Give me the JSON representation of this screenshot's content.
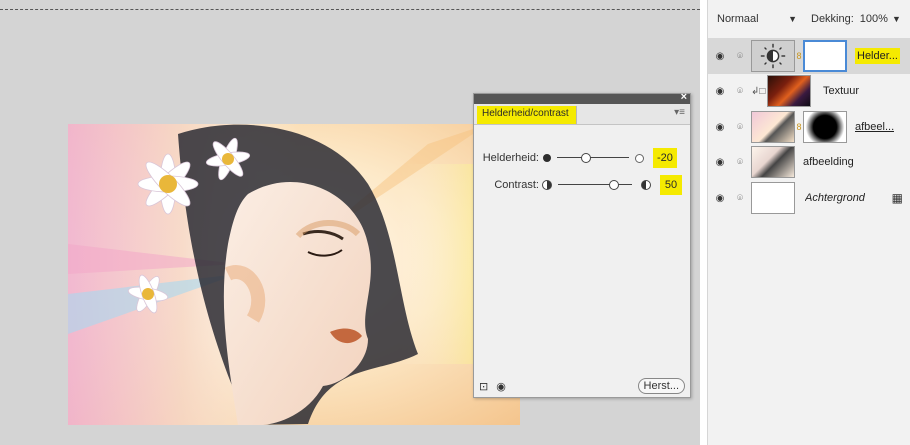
{
  "adjust_panel": {
    "close_glyph": "×",
    "tab_title": "Helderheid/contrast",
    "menu_glyph": "▾≡",
    "brightness": {
      "label": "Helderheid:",
      "value": "-20",
      "slider_fraction": 0.4
    },
    "contrast": {
      "label": "Contrast:",
      "value": "50",
      "slider_fraction": 0.75
    },
    "bottom_icons": [
      "clip-to-layer-icon",
      "eye-icon"
    ],
    "reset_label": "Herst..."
  },
  "layers_panel": {
    "blend_mode": "Normaal",
    "opacity_label": "Dekking:",
    "opacity_value": "100%",
    "layers": [
      {
        "name": "Helder...",
        "highlighted": true,
        "selected": true,
        "thumb": "brightness-adjustment-icon",
        "has_mask": true
      },
      {
        "name": "Textuur",
        "clipped": true,
        "thumb": "texture-thumbnail"
      },
      {
        "name": "afbeel...",
        "underlined": true,
        "thumb": "portrait-thumbnail",
        "has_mask": true
      },
      {
        "name": "afbeelding",
        "thumb": "portrait-thumbnail"
      },
      {
        "name": "Achtergrond",
        "italic": true,
        "locked": true,
        "thumb": "white-thumbnail"
      }
    ]
  },
  "colors": {
    "highlight": "#f5ea00",
    "workspace": "#d4d4d4",
    "panel_bg": "#f0f0f0",
    "selected_row": "#d8d8d8"
  }
}
